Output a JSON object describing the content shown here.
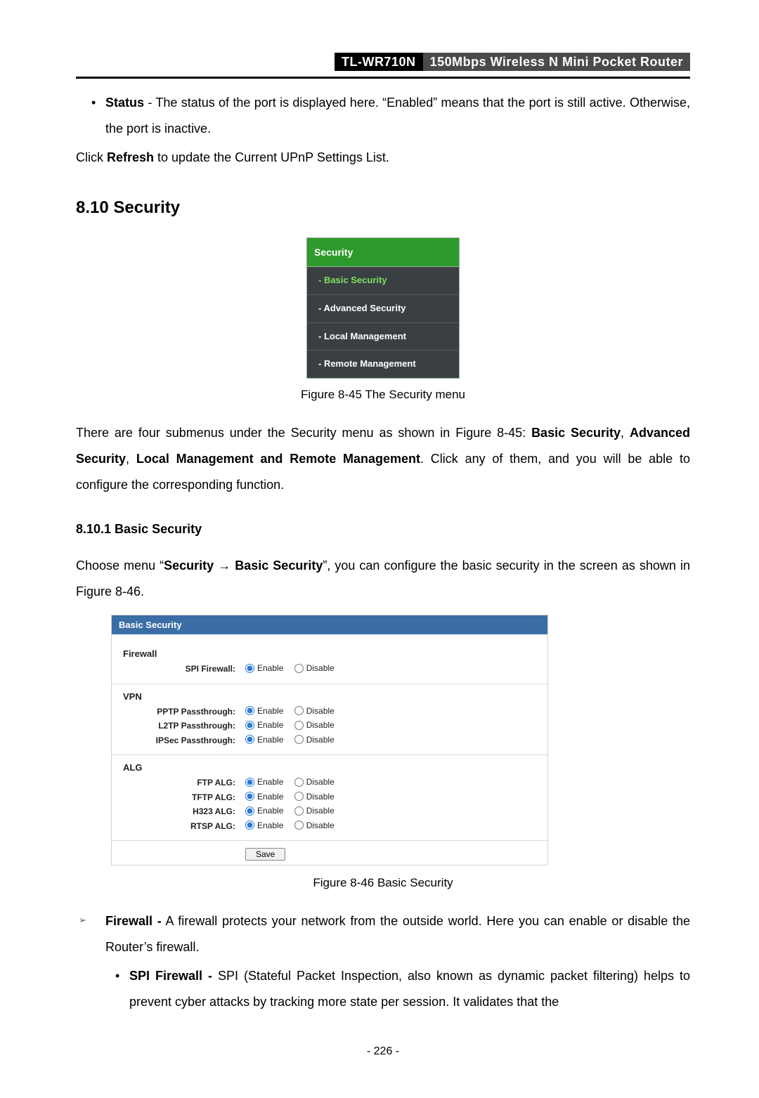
{
  "header": {
    "model": "TL-WR710N",
    "product": "150Mbps  Wireless  N  Mini  Pocket  Router"
  },
  "intro_bullet": {
    "label": "Status",
    "text": " - The status of the port is displayed here. “Enabled” means that the port is still active. Otherwise, the port is inactive."
  },
  "refresh_line": {
    "pre": "Click ",
    "bold": "Refresh",
    "post": " to update the Current UPnP Settings List."
  },
  "sec_heading": "8.10 Security",
  "menu": {
    "header": "Security",
    "items": [
      "- Basic Security",
      "- Advanced Security",
      "- Local Management",
      "- Remote Management"
    ],
    "caption": "Figure 8-45 The Security menu"
  },
  "para_menu": {
    "pre": "There are four submenus under the Security menu as shown in Figure 8-45: ",
    "b1": "Basic Security",
    "mid1": ", ",
    "b2": "Advanced Security",
    "mid2": ", ",
    "b3": "Local Management and Remote Management",
    "post": ". Click any of them, and you will be able to configure the corresponding function."
  },
  "subsec_heading": "8.10.1 Basic Security",
  "choose_line": {
    "pre": "Choose menu “",
    "b1": "Security",
    "arrow": "  →  ",
    "b2": "Basic Security",
    "post": "”, you can configure the basic security in the screen as shown in Figure 8-46."
  },
  "panel": {
    "title": "Basic Security",
    "groups": [
      {
        "name": "Firewall",
        "rows": [
          {
            "label": "SPI Firewall:",
            "enable": "Enable",
            "disable": "Disable",
            "sel": "enable"
          }
        ]
      },
      {
        "name": "VPN",
        "rows": [
          {
            "label": "PPTP Passthrough:",
            "enable": "Enable",
            "disable": "Disable",
            "sel": "enable"
          },
          {
            "label": "L2TP Passthrough:",
            "enable": "Enable",
            "disable": "Disable",
            "sel": "enable"
          },
          {
            "label": "IPSec Passthrough:",
            "enable": "Enable",
            "disable": "Disable",
            "sel": "enable"
          }
        ]
      },
      {
        "name": "ALG",
        "rows": [
          {
            "label": "FTP ALG:",
            "enable": "Enable",
            "disable": "Disable",
            "sel": "enable"
          },
          {
            "label": "TFTP ALG:",
            "enable": "Enable",
            "disable": "Disable",
            "sel": "enable"
          },
          {
            "label": "H323 ALG:",
            "enable": "Enable",
            "disable": "Disable",
            "sel": "enable"
          },
          {
            "label": "RTSP ALG:",
            "enable": "Enable",
            "disable": "Disable",
            "sel": "enable"
          }
        ]
      }
    ],
    "save": "Save",
    "caption": "Figure 8-46 Basic Security"
  },
  "firewall_bullet": {
    "label": "Firewall -",
    "text": " A firewall protects your network from the outside world. Here you can enable or disable the Router’s firewall."
  },
  "spi_bullet": {
    "label": "SPI Firewall -",
    "text": " SPI (Stateful Packet Inspection, also known as dynamic packet filtering) helps to prevent cyber attacks by tracking more state per session. It validates that the"
  },
  "page_number": "- 226 -"
}
